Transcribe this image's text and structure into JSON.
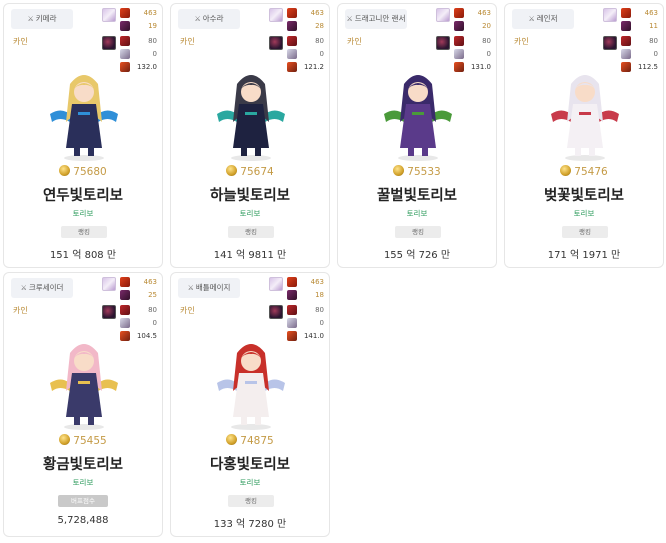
{
  "cards": [
    {
      "class_label": "키메라",
      "server": "카인",
      "stats": [
        "463",
        "19",
        "80",
        "0",
        "132.0"
      ],
      "fame": "75680",
      "name": "연두빛토리보",
      "adventure": "토리보",
      "button": "랭킹",
      "score": "151 억 808 만",
      "colors": {
        "hair": "#e8c86a",
        "outfit": "#2a2f5a",
        "accent": "#2f8fd8"
      }
    },
    {
      "class_label": "아수라",
      "server": "카인",
      "stats": [
        "463",
        "28",
        "80",
        "0",
        "121.2"
      ],
      "fame": "75674",
      "name": "하늘빛토리보",
      "adventure": "토리보",
      "button": "랭킹",
      "score": "141 억 9811 만",
      "colors": {
        "hair": "#3a3a48",
        "outfit": "#1e2240",
        "accent": "#2aa8a0"
      }
    },
    {
      "class_label": "드래고니안 랜서",
      "server": "카인",
      "stats": [
        "463",
        "20",
        "80",
        "0",
        "131.0"
      ],
      "fame": "75533",
      "name": "꿀벌빛토리보",
      "adventure": "토리보",
      "button": "랭킹",
      "score": "155 억 726 만",
      "colors": {
        "hair": "#3a2a6a",
        "outfit": "#5a3a8a",
        "accent": "#4a9a3a"
      }
    },
    {
      "class_label": "레인저",
      "server": "카인",
      "stats": [
        "463",
        "11",
        "80",
        "0",
        "112.5"
      ],
      "fame": "75476",
      "name": "벚꽃빛토리보",
      "adventure": "토리보",
      "button": "랭킹",
      "score": "171 억 1971 만",
      "colors": {
        "hair": "#e8e4ee",
        "outfit": "#f4f0f4",
        "accent": "#c83a4a"
      }
    },
    {
      "class_label": "크루세이더",
      "server": "카인",
      "stats": [
        "463",
        "25",
        "80",
        "0",
        "104.5"
      ],
      "fame": "75455",
      "name": "황금빛토리보",
      "adventure": "토리보",
      "button": "버프점수",
      "score": "5,728,488",
      "colors": {
        "hair": "#f2b8c8",
        "outfit": "#3a3a6a",
        "accent": "#e8c050"
      }
    },
    {
      "class_label": "배틀메이지",
      "server": "카인",
      "stats": [
        "463",
        "18",
        "80",
        "0",
        "141.0"
      ],
      "fame": "74875",
      "name": "다홍빛토리보",
      "adventure": "토리보",
      "button": "랭킹",
      "score": "133 억 7280 만",
      "colors": {
        "hair": "#c8302a",
        "outfit": "#f4eeee",
        "accent": "#b8c4e8"
      }
    }
  ]
}
